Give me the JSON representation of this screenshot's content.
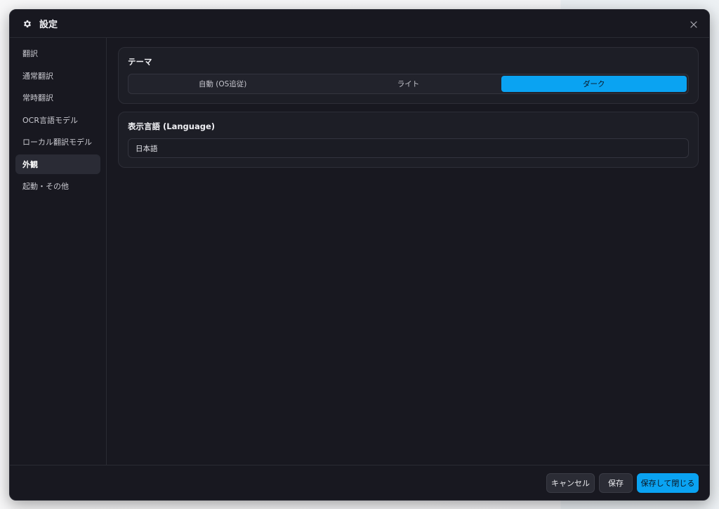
{
  "window": {
    "title": "設定",
    "icon": "gear-icon",
    "close_icon": "close-icon"
  },
  "sidebar": {
    "items": [
      {
        "label": "翻訳",
        "active": false
      },
      {
        "label": "通常翻訳",
        "active": false
      },
      {
        "label": "常時翻訳",
        "active": false
      },
      {
        "label": "OCR言語モデル",
        "active": false
      },
      {
        "label": "ローカル翻訳モデル",
        "active": false
      },
      {
        "label": "外観",
        "active": true
      },
      {
        "label": "起動・その他",
        "active": false
      }
    ]
  },
  "theme": {
    "title": "テーマ",
    "options": [
      "自動 (OS追従)",
      "ライト",
      "ダーク"
    ],
    "selected": "ダーク"
  },
  "language": {
    "title": "表示言語 (Language)",
    "value": "日本語"
  },
  "footer": {
    "cancel_label": "キャンセル",
    "save_label": "保存",
    "save_close_label": "保存して閉じる"
  },
  "colors": {
    "accent": "#0aa3f2",
    "background": "#181820",
    "card": "#1d1e26"
  }
}
